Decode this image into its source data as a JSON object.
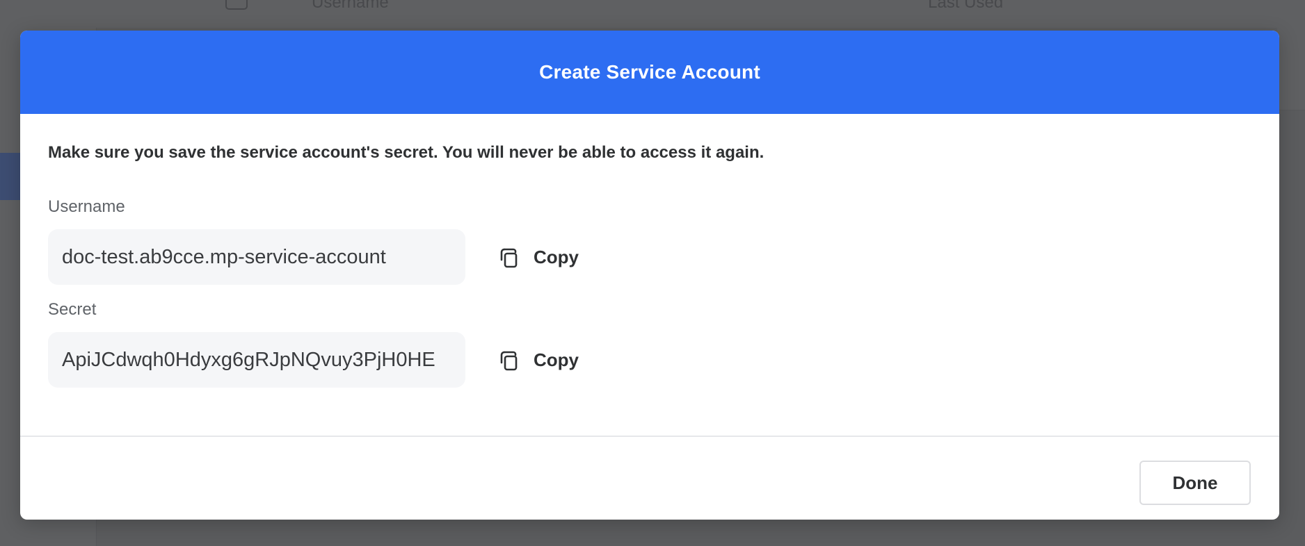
{
  "background": {
    "columns": {
      "username": "Username",
      "last_used": "Last Used"
    }
  },
  "modal": {
    "title": "Create Service Account",
    "warning": "Make sure you save the service account's secret. You will never be able to access it again.",
    "username": {
      "label": "Username",
      "value": "doc-test.ab9cce.mp-service-account",
      "copy_label": "Copy",
      "copy_icon": "copy-icon"
    },
    "secret": {
      "label": "Secret",
      "value": "ApiJCdwqh0Hdyxg6gRJpNQvuy3PjH0HE",
      "copy_label": "Copy",
      "copy_icon": "copy-icon"
    },
    "done_label": "Done"
  },
  "colors": {
    "header": "#2d6df2",
    "overlay": "#5b5c5e",
    "input_bg": "#f5f6f8",
    "text": "#2f3133",
    "label": "#5f6368"
  }
}
